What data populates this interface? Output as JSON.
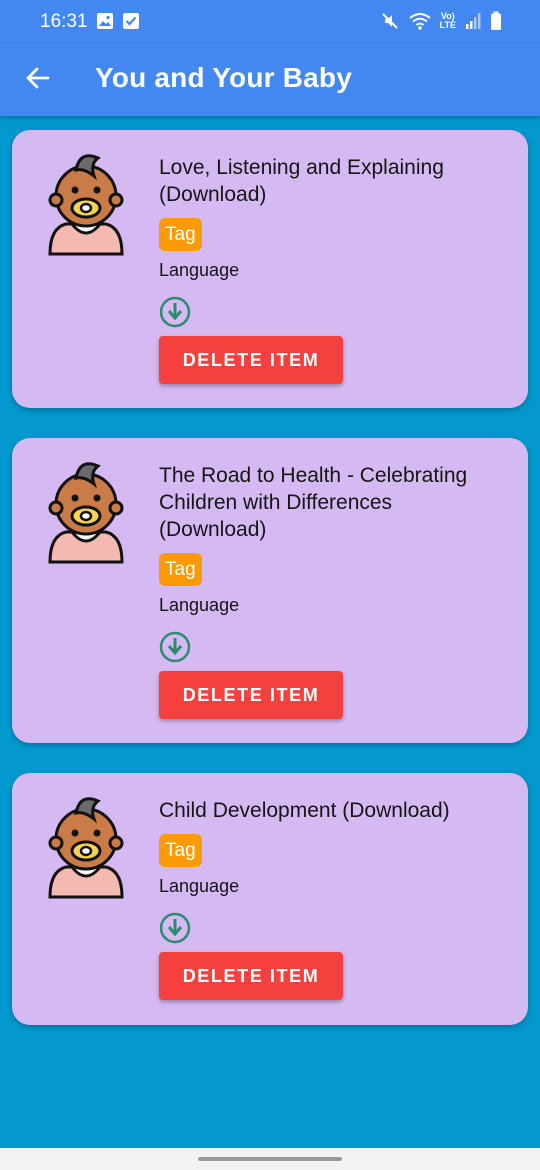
{
  "status_bar": {
    "time": "16:31",
    "icons": [
      "image-icon",
      "check-square-icon",
      "mute-icon",
      "wifi-icon",
      "volte-icon",
      "signal-icon",
      "battery-icon"
    ],
    "volte_line1": "Vo)",
    "volte_line2": "LTE"
  },
  "app_bar": {
    "back_icon": "arrow-left-icon",
    "title": "You and Your Baby"
  },
  "colors": {
    "app_bar": "#4388f0",
    "background": "#0399cf",
    "card": "#d5b9f2",
    "tag": "#fb9a05",
    "delete": "#f6403d",
    "download": "#2a8c6c"
  },
  "items": [
    {
      "title": "Love, Listening and Explaining (Download)",
      "tag": "Tag",
      "language": "Language",
      "delete_label": "DELETE ITEM"
    },
    {
      "title": "The Road to Health - Celebrating Children with Differences (Download)",
      "tag": "Tag",
      "language": "Language",
      "delete_label": "DELETE ITEM"
    },
    {
      "title": "Child Development (Download)",
      "tag": "Tag",
      "language": "Language",
      "delete_label": "DELETE ITEM"
    }
  ]
}
